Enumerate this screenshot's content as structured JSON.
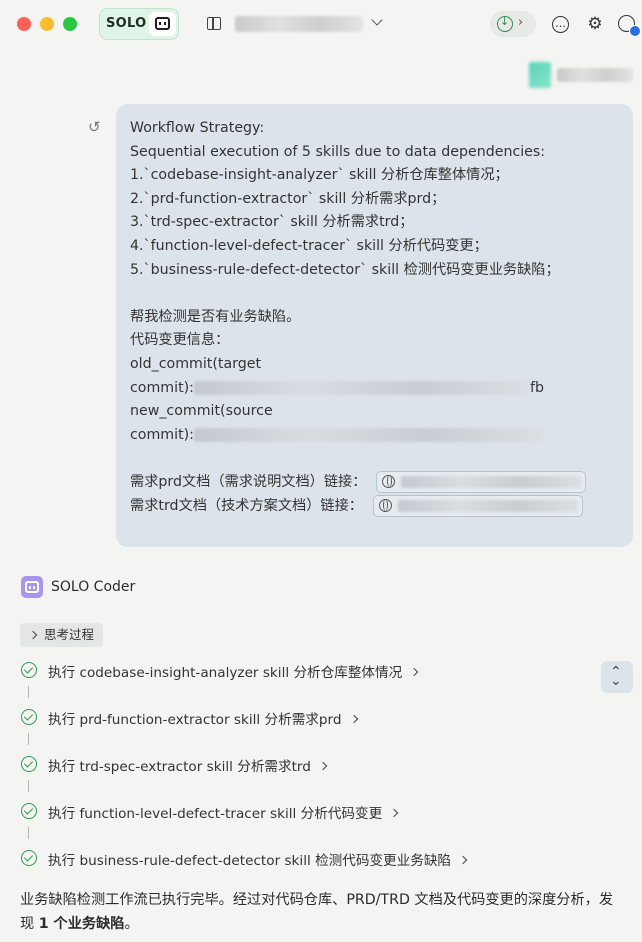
{
  "header": {
    "badge_label": "SOLO",
    "icons": [
      "solo-bot-icon",
      "sidebar-toggle-icon",
      "chevron-down-icon",
      "sync-download-icon",
      "chevron-right-icon",
      "new-chat-icon",
      "gear-icon",
      "user-avatar-icon"
    ]
  },
  "message": {
    "lines": [
      "Workflow Strategy:",
      "Sequential execution of 5 skills due to data dependencies:",
      "1.`codebase-insight-analyzer` skill 分析仓库整体情况；",
      "2.`prd-function-extractor` skill 分析需求prd；",
      "3.`trd-spec-extractor` skill 分析需求trd；",
      "4.`function-level-defect-tracer` skill 分析代码变更；",
      "5.`business-rule-defect-detector` skill 检测代码变更业务缺陷；",
      "",
      "帮我检测是否有业务缺陷。",
      "代码变更信息：",
      "old_commit(target"
    ],
    "old_commit_prefix": "commit):",
    "old_commit_suffix": "fb",
    "new_commit_label": "new_commit(source",
    "new_commit_prefix": "commit):",
    "prd_label": "需求prd文档（需求说明文档）链接：",
    "trd_label": "需求trd文档（技术方案文档）链接："
  },
  "agent": {
    "name": "SOLO Coder",
    "thinking_label": "思考过程",
    "steps": [
      "执行 codebase-insight-analyzer skill 分析仓库整体情况",
      "执行 prd-function-extractor skill 分析需求prd",
      "执行 trd-spec-extractor skill 分析需求trd",
      "执行 function-level-defect-tracer skill 分析代码变更",
      "执行 business-rule-defect-detector skill 检测代码变更业务缺陷"
    ],
    "summary_text": "业务缺陷检测工作流已执行完毕。经过对代码仓库、PRD/TRD 文档及代码变更的深度分析，发现 ",
    "summary_bold": "1 个业务缺陷",
    "summary_end": "。"
  },
  "colors": {
    "bubble_bg": "#dde3ea",
    "accent_green": "#2f9a4f",
    "agent_purple": "#a797e9",
    "badge_bg": "#dff4e6"
  }
}
